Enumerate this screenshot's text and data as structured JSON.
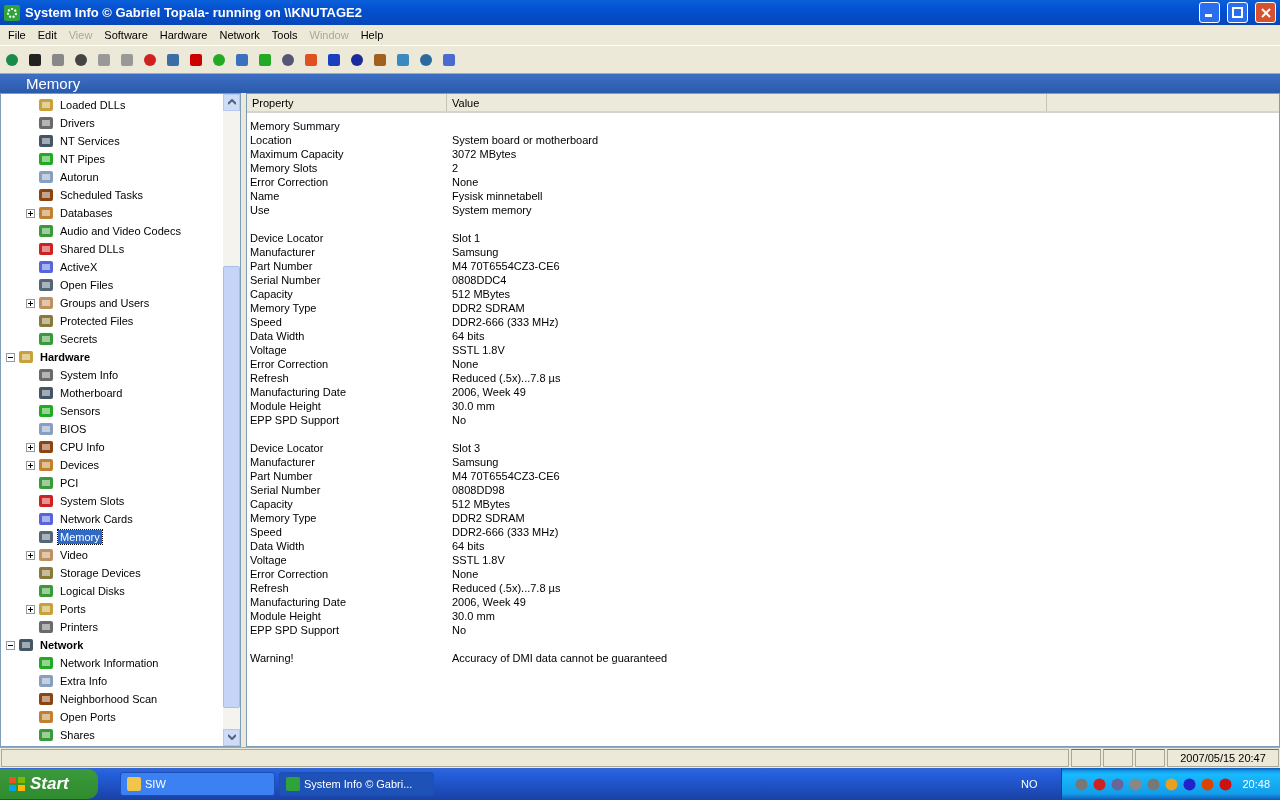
{
  "window": {
    "title": "System Info  © Gabriel Topala- running on \\\\KNUTAGE2"
  },
  "menu": [
    {
      "label": "File",
      "disabled": false
    },
    {
      "label": "Edit",
      "disabled": false
    },
    {
      "label": "View",
      "disabled": true
    },
    {
      "label": "Software",
      "disabled": false
    },
    {
      "label": "Hardware",
      "disabled": false
    },
    {
      "label": "Network",
      "disabled": false
    },
    {
      "label": "Tools",
      "disabled": false
    },
    {
      "label": "Window",
      "disabled": true
    },
    {
      "label": "Help",
      "disabled": false
    }
  ],
  "section_header": "Memory",
  "tree": [
    {
      "children": [
        {
          "label": "Loaded DLLs",
          "selected": false
        },
        {
          "label": "Drivers",
          "selected": false
        },
        {
          "label": "NT Services",
          "selected": false
        },
        {
          "label": "NT Pipes",
          "selected": false
        },
        {
          "label": "Autorun",
          "selected": false
        },
        {
          "label": "Scheduled Tasks",
          "selected": false
        },
        {
          "label": "Databases",
          "selected": false,
          "expanded": false
        },
        {
          "label": "Audio and Video Codecs",
          "selected": false
        },
        {
          "label": "Shared DLLs",
          "selected": false
        },
        {
          "label": "ActiveX",
          "selected": false
        },
        {
          "label": "Open Files",
          "selected": false
        },
        {
          "label": "Groups and Users",
          "selected": false,
          "expanded": false
        },
        {
          "label": "Protected Files",
          "selected": false
        },
        {
          "label": "Secrets",
          "selected": false
        }
      ]
    },
    {
      "label": "Hardware",
      "selected": false,
      "expanded": true,
      "children": [
        {
          "label": "System Info",
          "selected": false
        },
        {
          "label": "Motherboard",
          "selected": false
        },
        {
          "label": "Sensors",
          "selected": false
        },
        {
          "label": "BIOS",
          "selected": false
        },
        {
          "label": "CPU Info",
          "selected": false,
          "expanded": false
        },
        {
          "label": "Devices",
          "selected": false,
          "expanded": false
        },
        {
          "label": "PCI",
          "selected": false
        },
        {
          "label": "System Slots",
          "selected": false
        },
        {
          "label": "Network Cards",
          "selected": false
        },
        {
          "label": "Memory",
          "selected": true
        },
        {
          "label": "Video",
          "selected": false,
          "expanded": false
        },
        {
          "label": "Storage Devices",
          "selected": false
        },
        {
          "label": "Logical Disks",
          "selected": false
        },
        {
          "label": "Ports",
          "selected": false,
          "expanded": false
        },
        {
          "label": "Printers",
          "selected": false
        }
      ]
    },
    {
      "label": "Network",
      "selected": false,
      "expanded": true,
      "children": [
        {
          "label": "Network Information",
          "selected": false
        },
        {
          "label": "Extra Info",
          "selected": false
        },
        {
          "label": "Neighborhood Scan",
          "selected": false
        },
        {
          "label": "Open Ports",
          "selected": false
        },
        {
          "label": "Shares",
          "selected": false
        }
      ]
    }
  ],
  "table": {
    "columns": [
      "Property",
      "Value"
    ],
    "sections": [
      [
        {
          "property": "Memory Summary"
        },
        {
          "property": "Location",
          "value": "System board or motherboard"
        },
        {
          "property": "Maximum Capacity",
          "value": "3072 MBytes"
        },
        {
          "property": "Memory Slots",
          "value": "2"
        },
        {
          "property": "Error Correction",
          "value": "None"
        },
        {
          "property": "Name",
          "value": "Fysisk minnetabell"
        },
        {
          "property": "Use",
          "value": "System memory"
        }
      ],
      [
        {
          "property": "Device Locator",
          "value": "Slot 1"
        },
        {
          "property": "Manufacturer",
          "value": "Samsung"
        },
        {
          "property": "Part Number",
          "value": "M4 70T6554CZ3-CE6"
        },
        {
          "property": "Serial Number",
          "value": "0808DDC4"
        },
        {
          "property": "Capacity",
          "value": "512 MBytes"
        },
        {
          "property": "Memory Type",
          "value": "DDR2 SDRAM"
        },
        {
          "property": "Speed",
          "value": "DDR2-666 (333 MHz)"
        },
        {
          "property": "Data Width",
          "value": "64 bits"
        },
        {
          "property": "Voltage",
          "value": "SSTL 1.8V"
        },
        {
          "property": "Error Correction",
          "value": "None"
        },
        {
          "property": "Refresh",
          "value": "Reduced (.5x)...7.8 µs"
        },
        {
          "property": "Manufacturing Date",
          "value": "2006, Week 49"
        },
        {
          "property": "Module Height",
          "value": "30.0 mm"
        },
        {
          "property": "EPP SPD Support",
          "value": "No"
        }
      ],
      [
        {
          "property": "Device Locator",
          "value": "Slot 3"
        },
        {
          "property": "Manufacturer",
          "value": "Samsung"
        },
        {
          "property": "Part Number",
          "value": "M4 70T6554CZ3-CE6"
        },
        {
          "property": "Serial Number",
          "value": "0808DD98"
        },
        {
          "property": "Capacity",
          "value": "512 MBytes"
        },
        {
          "property": "Memory Type",
          "value": "DDR2 SDRAM"
        },
        {
          "property": "Speed",
          "value": "DDR2-666 (333 MHz)"
        },
        {
          "property": "Data Width",
          "value": "64 bits"
        },
        {
          "property": "Voltage",
          "value": "SSTL 1.8V"
        },
        {
          "property": "Error Correction",
          "value": "None"
        },
        {
          "property": "Refresh",
          "value": "Reduced (.5x)...7.8 µs"
        },
        {
          "property": "Manufacturing Date",
          "value": "2006, Week 49"
        },
        {
          "property": "Module Height",
          "value": "30.0 mm"
        },
        {
          "property": "EPP SPD Support",
          "value": "No"
        }
      ],
      [
        {
          "property": "Warning!",
          "value": "Accuracy of DMI data cannot be guaranteed"
        }
      ]
    ]
  },
  "status_bar": {
    "datetime": "2007/05/15 20:47"
  },
  "taskbar": {
    "start": "Start",
    "tasks": [
      {
        "label": "SIW",
        "selected": false
      },
      {
        "label": "System Info  © Gabri...",
        "selected": true
      }
    ],
    "language": "NO",
    "clock": "20:48"
  }
}
